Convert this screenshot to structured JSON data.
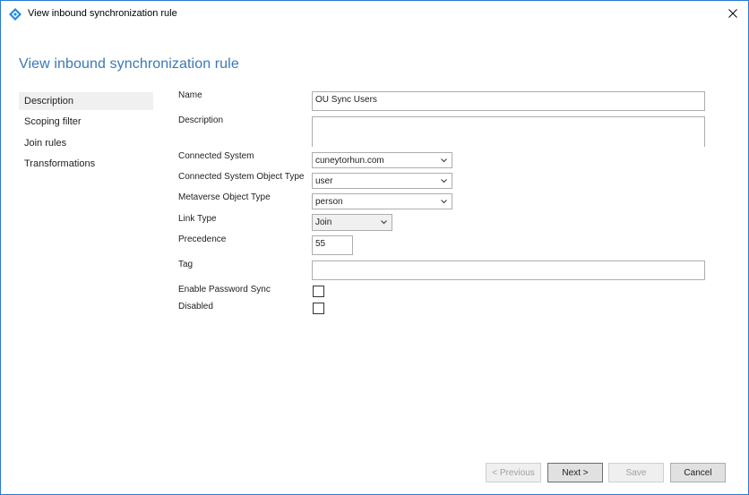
{
  "window": {
    "title": "View inbound synchronization rule"
  },
  "page": {
    "title": "View inbound synchronization rule"
  },
  "nav": {
    "items": [
      {
        "label": "Description"
      },
      {
        "label": "Scoping filter"
      },
      {
        "label": "Join rules"
      },
      {
        "label": "Transformations"
      }
    ]
  },
  "form": {
    "name": {
      "label": "Name",
      "value": "OU Sync Users"
    },
    "description": {
      "label": "Description",
      "value": ""
    },
    "connected_system": {
      "label": "Connected System",
      "value": "cuneytorhun.com"
    },
    "cs_object_type": {
      "label": "Connected System Object Type",
      "value": "user"
    },
    "mv_object_type": {
      "label": "Metaverse Object Type",
      "value": "person"
    },
    "link_type": {
      "label": "Link Type",
      "value": "Join"
    },
    "precedence": {
      "label": "Precedence",
      "value": "55"
    },
    "tag": {
      "label": "Tag",
      "value": ""
    },
    "enable_password_sync": {
      "label": "Enable Password Sync",
      "checked": false
    },
    "disabled": {
      "label": "Disabled",
      "checked": false
    }
  },
  "buttons": {
    "previous": "< Previous",
    "next": "Next >",
    "save": "Save",
    "cancel": "Cancel"
  },
  "colors": {
    "accent": "#3a78b5",
    "border": "#2b79d6"
  }
}
